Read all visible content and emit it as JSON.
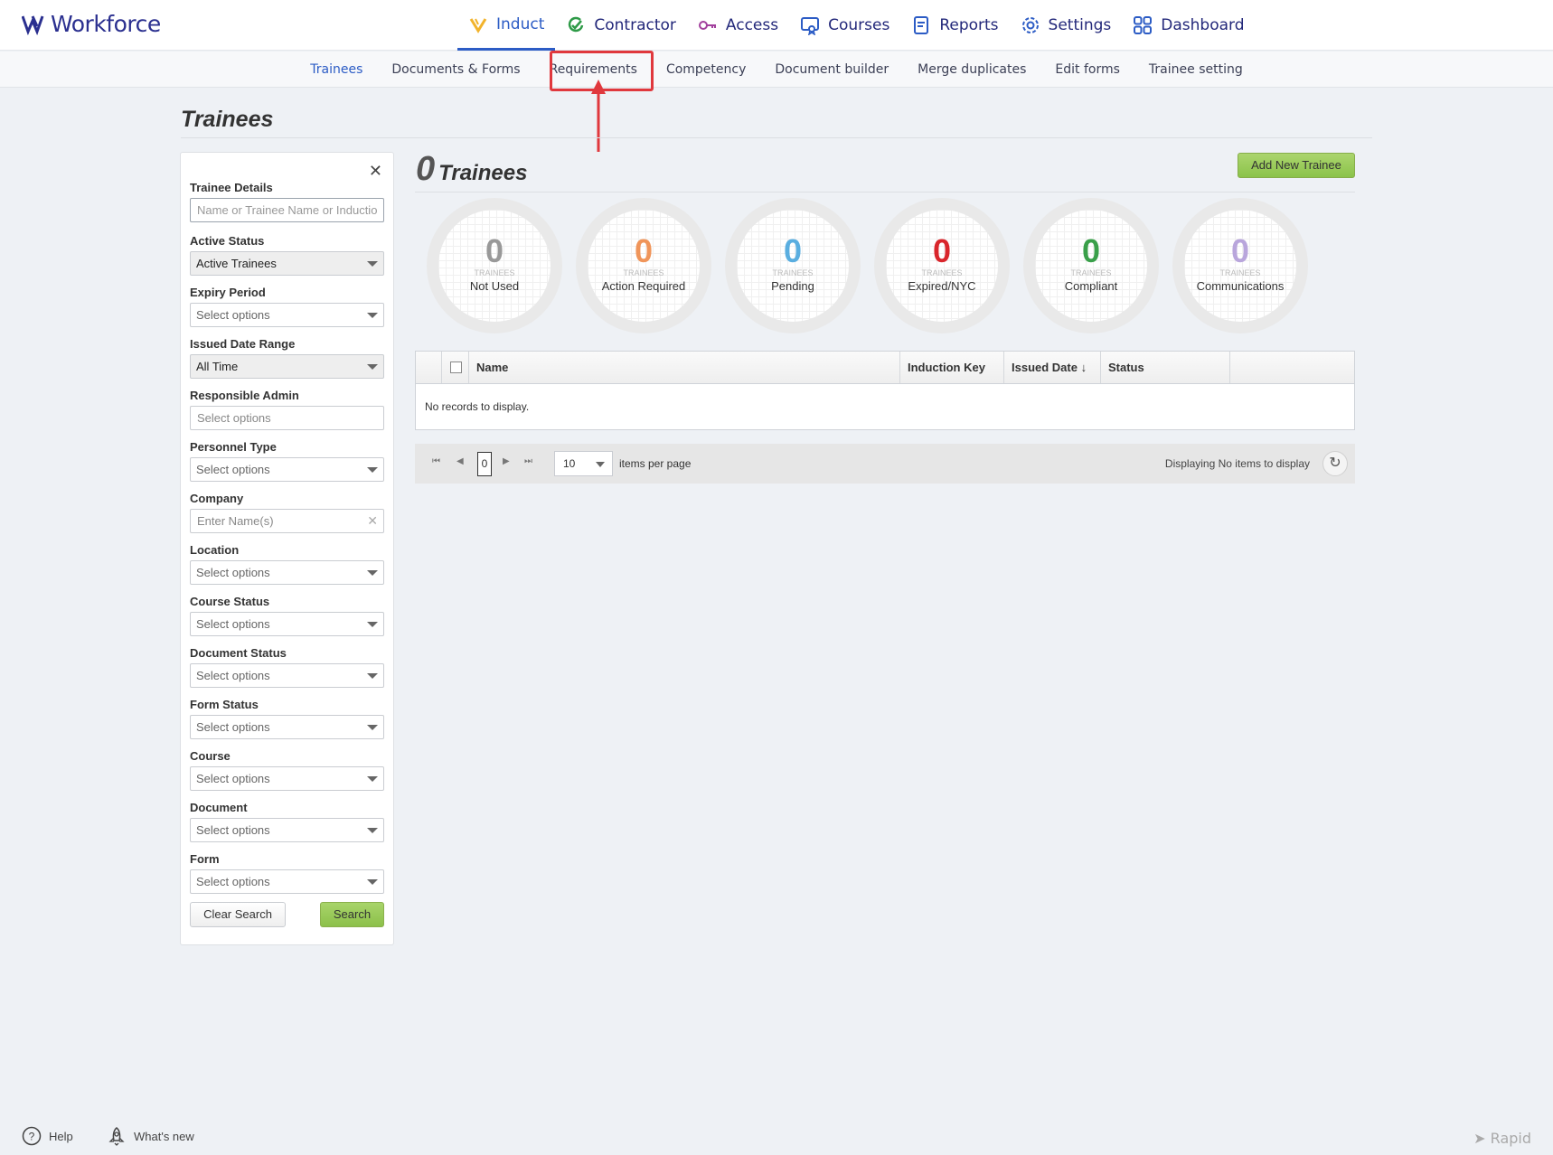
{
  "app": {
    "logo_text": "Workforce"
  },
  "mainnav": [
    {
      "label": "Induct",
      "icon": "induct-icon",
      "active": true
    },
    {
      "label": "Contractor",
      "icon": "contractor-icon"
    },
    {
      "label": "Access",
      "icon": "key-icon"
    },
    {
      "label": "Courses",
      "icon": "courses-icon"
    },
    {
      "label": "Reports",
      "icon": "reports-icon"
    },
    {
      "label": "Settings",
      "icon": "gear-icon"
    },
    {
      "label": "Dashboard",
      "icon": "dashboard-icon"
    }
  ],
  "subnav": [
    "Trainees",
    "Documents & Forms",
    "Requirements",
    "Competency",
    "Document builder",
    "Merge duplicates",
    "Edit forms",
    "Trainee setting"
  ],
  "page": {
    "title": "Trainees"
  },
  "filters": {
    "close": "✕",
    "trainee_details": {
      "label": "Trainee Details",
      "placeholder": "Name or Trainee Name or Induction Key"
    },
    "active_status": {
      "label": "Active Status",
      "value": "Active Trainees"
    },
    "expiry_period": {
      "label": "Expiry Period",
      "value": "Select options"
    },
    "issued_date_range": {
      "label": "Issued Date Range",
      "value": "All Time"
    },
    "responsible_admin": {
      "label": "Responsible Admin",
      "value": "Select options"
    },
    "personnel_type": {
      "label": "Personnel Type",
      "value": "Select options"
    },
    "company": {
      "label": "Company",
      "value": "Enter Name(s)"
    },
    "location": {
      "label": "Location",
      "value": "Select options"
    },
    "course_status": {
      "label": "Course Status",
      "value": "Select options"
    },
    "document_status": {
      "label": "Document Status",
      "value": "Select options"
    },
    "form_status": {
      "label": "Form Status",
      "value": "Select options"
    },
    "course": {
      "label": "Course",
      "value": "Select options"
    },
    "document": {
      "label": "Document",
      "value": "Select options"
    },
    "form": {
      "label": "Form",
      "value": "Select options"
    },
    "clear_button": "Clear Search",
    "search_button": "Search"
  },
  "main": {
    "count": "0",
    "count_label": "Trainees",
    "add_button": "Add New Trainee"
  },
  "stats": [
    {
      "value": "0",
      "small": "TRAINEES",
      "caption": "Not Used",
      "color": "#999999"
    },
    {
      "value": "0",
      "small": "TRAINEES",
      "caption": "Action Required",
      "color": "#f0955a"
    },
    {
      "value": "0",
      "small": "TRAINEES",
      "caption": "Pending",
      "color": "#5aaee0"
    },
    {
      "value": "0",
      "small": "TRAINEES",
      "caption": "Expired/NYC",
      "color": "#d9262c"
    },
    {
      "value": "0",
      "small": "TRAINEES",
      "caption": "Compliant",
      "color": "#3aa04a"
    },
    {
      "value": "0",
      "small": "TRAINEES",
      "caption": "Communications",
      "color": "#b9a6dc"
    }
  ],
  "grid": {
    "columns": [
      "Name",
      "Induction Key",
      "Issued Date ↓",
      "Status"
    ],
    "empty": "No records to display."
  },
  "pager": {
    "page": "0",
    "page_size": "10",
    "items_per_page": "items per page",
    "display": "Displaying No items to display"
  },
  "footer": {
    "help": "Help",
    "whats_new": "What's new",
    "brand": "Rapid"
  }
}
